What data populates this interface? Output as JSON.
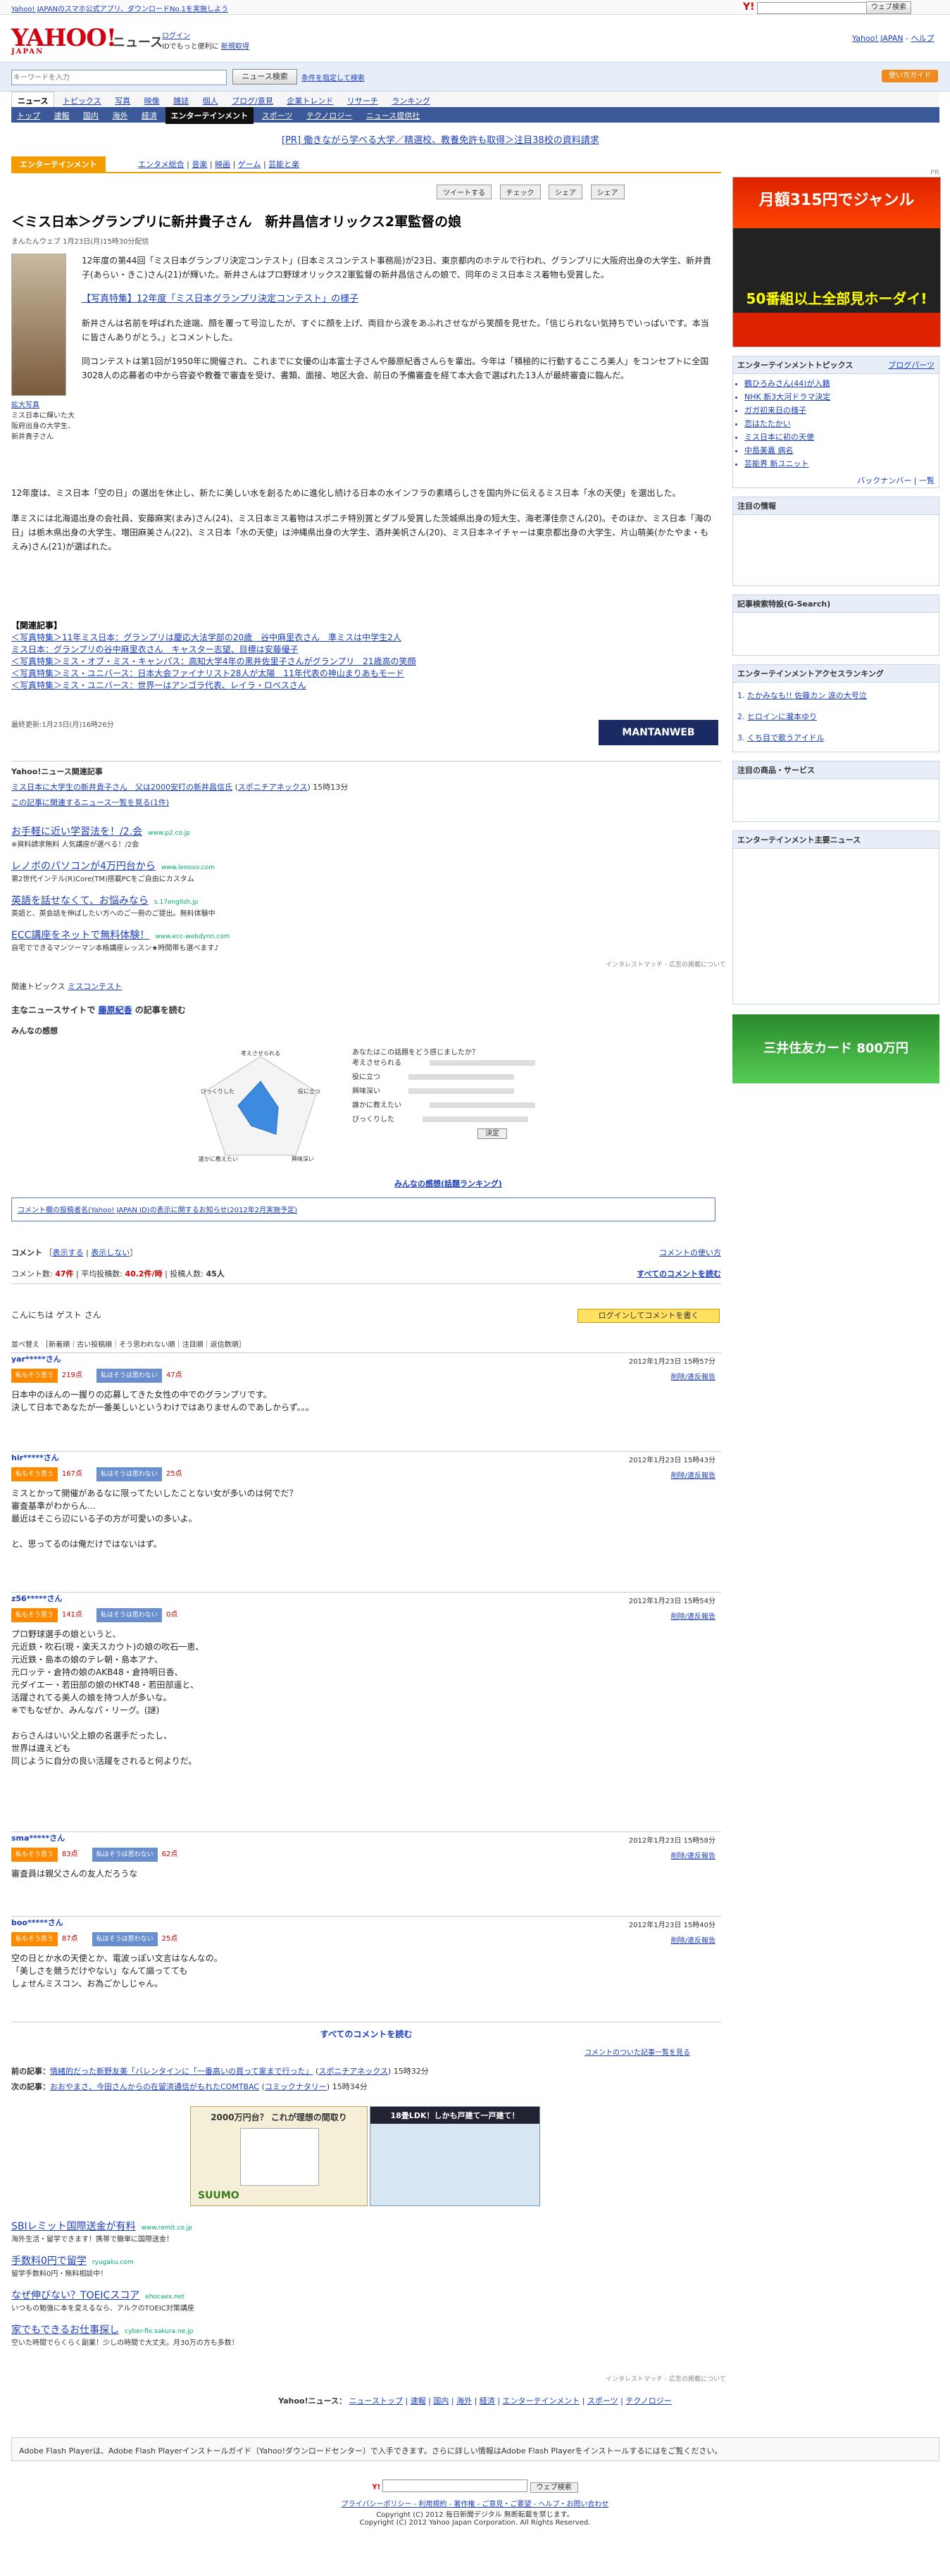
{
  "topbar": {
    "notice": "Yahoo! JAPANのスマホ公式アプリ、ダウンロードNo.1を実施しよう",
    "search_button": "ウェブ検索"
  },
  "header": {
    "logo": "YAHOO!",
    "logo_sub": "JAPAN",
    "service": "ニュース",
    "login": "ログイン",
    "login_note": "IDでもっと便利に",
    "register": "新規取得",
    "yahoo_top": "Yahoo! JAPAN",
    "help": "ヘルプ"
  },
  "search": {
    "placeholder": "キーワードを入力",
    "button": "ニュース検索",
    "advanced": "条件を指定して検索",
    "help_button": "使い方ガイド"
  },
  "nav_primary": [
    "ニュース",
    "トピックス",
    "写真",
    "映像",
    "雑誌",
    "個人",
    "ブログ/意見",
    "企業トレンド",
    "リサーチ",
    "ランキング"
  ],
  "nav_secondary": [
    "トップ",
    "速報",
    "国内",
    "海外",
    "経済",
    "エンターテインメント",
    "スポーツ",
    "テクノロジー",
    "ニュース提供社"
  ],
  "pr_line": "[PR] 働きながら学べる大学／精選校、教養免許も取得＞注目38校の資料請求",
  "category": {
    "label": "エンターテインメント",
    "subs": [
      "エンタメ総合",
      "音楽",
      "映画",
      "ゲーム",
      "芸能と楽"
    ]
  },
  "social": [
    "ツイートする",
    "チェック",
    "シェア",
    "シェア"
  ],
  "article": {
    "title": "＜ミス日本＞グランプリに新井貴子さん　新井昌信オリックス2軍監督の娘",
    "byline": "まんたんウェブ 1月23日(月)15時30分配信",
    "photo_caption": "ミス日本に輝いた大阪府出身の大学生、新井貴子さん",
    "photo_link": "拡大写真",
    "p1": "12年度の第44回「ミス日本グランプリ決定コンテスト」(日本ミスコンテスト事務局)が23日、東京都内のホテルで行われ、グランプリに大阪府出身の大学生、新井貴子(あらい・きこ)さん(21)が輝いた。新井さんはプロ野球オリックス2軍監督の新井昌信さんの娘で、同年のミス日本ミス着物も受賞した。",
    "special_link": "【写真特集】12年度「ミス日本グランプリ決定コンテスト」の様子",
    "p2": "新井さんは名前を呼ばれた途端、顔を覆って号泣したが、すぐに顔を上げ、両目から涙をあふれさせながら笑顔を見せた。「信じられない気持ちでいっぱいです。本当に皆さんありがとう。」とコメントした。",
    "p3": "同コンテストは第1回が1950年に開催され、これまでに女優の山本富士子さんや藤原紀香さんらを輩出。今年は「積極的に行動するこころ美人」をコンセプトに全国3028人の応募者の中から容姿や教養で審査を受け、書類、面接、地区大会、前日の予備審査を経て本大会で選ばれた13人が最終審査に臨んだ。",
    "p4": "12年度は、ミス日本「空の日」の選出を休止し、新たに美しい水を創るために進化し続ける日本の水インフラの素晴らしさを国内外に伝えるミス日本「水の天使」を選出した。",
    "p5": "準ミスには北海道出身の会社員、安藤麻実(まみ)さん(24)、ミス日本ミス着物はスポニチ特別賞とダブル受賞した茨城県出身の短大生、海老澤佳奈さん(20)。そのほか、ミス日本「海の日」は栃木県出身の大学生、増田麻美さん(22)、ミス日本「水の天使」は沖縄県出身の大学生、酒井美帆さん(20)、ミス日本ネイチャーは東京都出身の大学生、片山萌美(かたやま・もえみ)さん(21)が選ばれた。",
    "related_header": "【関連記事】",
    "related": [
      "＜写真特集＞11年ミス日本：グランプリは慶応大法学部の20歳　谷中麻里衣さん　準ミスは中学生2人",
      "ミス日本：グランプリの谷中麻里衣さん　キャスター志望、目標は安藤優子",
      "＜写真特集＞ミス・オブ・ミス・キャンパス：高知大学4年の黒井佐里子さんがグランプリ　21歳高の笑顔",
      "＜写真特集＞ミス・ユニバース：日本大会ファイナリスト28人が太陽　11年代表の神山まりあもモード",
      "＜写真特集＞ミス・ユニバース：世界一はアンゴラ代表、レイラ・ロペスさん"
    ],
    "updated": "最終更新:1月23日(月)16時26分",
    "source_logo": "MANTANWEB"
  },
  "related_news": {
    "header": "Yahoo!ニュース関連記事",
    "item": "ミス日本に大学生の新井貴子さん　父は2000安打の新井昌信氏",
    "source": "スポニチアネックス",
    "time": "15時13分",
    "more": "この記事に関連するニュース一覧を見る(1件)"
  },
  "ads": [
    {
      "h": "お手軽に近い学習法を！/2.会",
      "u": "www.p2.co.jp",
      "d": "※資料請求無料 人気講座が選べる！/2会"
    },
    {
      "h": "レノボのパソコンが4万円台から",
      "u": "www.lenovo.com",
      "d": "第2世代インテル(R)Core(TM)搭載PCをご自由にカスタム"
    },
    {
      "h": "英語を話せなくて、お悩みなら",
      "u": "s.17english.jp",
      "d": "英語と、英会話を伸ばしたい方へのご一冊のご提出。無料体験中"
    },
    {
      "h": "ECC講座をネットで無料体験！",
      "u": "www.ecc-webdynn.com",
      "d": "自宅でできるマンツーマン本格講座レッスン★時間帯も選べます♪"
    }
  ],
  "ad_footer": "インタレストマッチ - 広告の掲載について",
  "topics": {
    "label": "関連トピックス",
    "link": "ミスコンテスト"
  },
  "pickup": {
    "label": "主なニュースサイトで",
    "link": "藤原紀香",
    "suffix": "の記事を読む"
  },
  "feelings": {
    "label": "みんなの感想",
    "question": "あなたはこの話題をどう感じましたか？",
    "axes": [
      "考えさせられる",
      "役に立つ",
      "興味深い",
      "誰かに教えたい",
      "びっくりした"
    ],
    "values": [
      0.6,
      0.35,
      0.5,
      0.3,
      0.45
    ],
    "vote": "決定",
    "ranking": "みんなの感想(話題ランキング)"
  },
  "notice_box": "コメント欄の投稿者名(Yahoo! JAPAN ID)の表示に関するお知らせ(2012年2月実施予定)",
  "comments_meta": {
    "label": "コメント",
    "show": "表示する",
    "hide": "表示しない",
    "how": "コメントの使い方",
    "count_label": "コメント数",
    "count": "47件",
    "avg_label": "平均投稿数",
    "avg": "40.2件/時",
    "posters_label": "投稿人数",
    "posters": "45人",
    "see_all": "すべてのコメントを読む",
    "guest": "こんにちは ゲスト さん",
    "login_btn": "ログインしてコメントを書く",
    "sort": "並べ替え ［新着順｜古い投稿順｜そう思われない順｜注目順｜返信数順］"
  },
  "comments": [
    {
      "user": "yar*****さん",
      "date": "2012年1月23日 15時57分",
      "agree": "219点",
      "disagree": "47点",
      "text": "日本中のほんの一握りの応募してきた女性の中でのグランプリです。\n決して日本であなたが一番美しいというわけではありませんのであしからず。。。"
    },
    {
      "user": "hir*****さん",
      "date": "2012年1月23日 15時43分",
      "agree": "167点",
      "disagree": "25点",
      "text": "ミスとかって開催があるなに限ってたいしたことない女が多いのは何でだ？\n審査基準がわからん…\n最近はそこら辺にいる子の方が可愛いの多いよ。\n\nと、思ってるのは俺だけではないはず。"
    },
    {
      "user": "z56*****さん",
      "date": "2012年1月23日 15時54分",
      "agree": "141点",
      "disagree": "0点",
      "text": "プロ野球選手の娘というと、\n元近鉄・吹石(現・楽天スカウト)の娘の吹石一恵、\n元近鉄・島本の娘のテレ朝・島本アナ、\n元ロッテ・倉持の娘のAKB48・倉持明日香、\n元ダイエー・若田部の娘のHKT48・若田部遥と、\n活躍されてる美人の娘を持つ人が多いな。\n※でもなぜか、みんなパ・リーグ。(謎)\n\nおらさんはいい父上娘の名選手だったし、\n世界は違えども\n同じように自分の良い活躍をされると何よりだ。"
    },
    {
      "user": "sma*****さん",
      "date": "2012年1月23日 15時58分",
      "agree": "83点",
      "disagree": "62点",
      "text": "審査員は親父さんの友人だろうな"
    },
    {
      "user": "boo*****さん",
      "date": "2012年1月23日 15時40分",
      "agree": "87点",
      "disagree": "25点",
      "text": "空の日とか水の天使とか、電波っぽい文言はなんなの。\n「美しさを競うだけやない」なんて謳ってても\nしょせんミスコン、お為ごかしじゃん。"
    }
  ],
  "comment_vote_labels": {
    "agree": "私もそう思う",
    "disagree": "私はそうは思わない",
    "report": "削除/違反報告"
  },
  "all_comments": "すべてのコメントを読む",
  "comments_list_link": "コメントのついた記事一覧を見る",
  "prevnext": {
    "prev_label": "前の記事：",
    "prev": "情緒的だった新野友美「バレンタインに「一番高いの買って家まで行った」",
    "prev_src": "スポニチアネックス",
    "prev_time": "15時32分",
    "next_label": "次の記事：",
    "next": "おおやまさ、今田さんからの在留済通信がもれたCOMTBAC",
    "next_src": "コミックナタリー",
    "next_time": "15時34分"
  },
  "banner": {
    "title": "2000万円台？ これが理想の間取り",
    "brand": "SUUMO",
    "title2": "18畳LDK！しかも戸建て一戸建て！"
  },
  "ads2": [
    {
      "h": "SBIレミット国際送金が有料",
      "u": "www.remit.co.jp",
      "d": "海外生活・留学できます！携帯で簡単に国際送金！"
    },
    {
      "h": "手数料0円で留学",
      "u": "ryugaku.com",
      "d": "留学手数料0円・無料相談中！"
    },
    {
      "h": "なぜ伸びない？TOEICスコア",
      "u": "ehocaex.net",
      "d": "いつもの勉強に本を変えるなら、アルクのTOEIC対策講座"
    },
    {
      "h": "家でもできるお仕事探し",
      "u": "cyber-fle.sakura.ne.jp",
      "d": "空いた時間でらくらく副業！少しの時間で大丈夫。月30万の方も多数！"
    }
  ],
  "footnav": [
    "ニューストップ",
    "速報",
    "国内",
    "海外",
    "経済",
    "エンターテインメント",
    "スポーツ",
    "テクノロジー"
  ],
  "footnav_label": "Yahoo!ニュース：",
  "flash": "Adobe Flash Playerは、Adobe Flash Playerインストールガイド（Yahoo!ダウンロードセンター）で入手できます。さらに詳しい情報はAdobe Flash Playerをインストールするにはをご覧ください。",
  "footer": {
    "links": "プライバシーポリシー - 利用規約 - 著作権 - ご意見・ご要望 - ヘルプ・お問い合わせ",
    "copy1": "Copyright (C) 2012 毎日新聞デジタル 無断転載を禁じます。",
    "copy2": "Copyright (C) 2012 Yahoo Japan Corporation. All Rights Reserved."
  },
  "right": {
    "pr": "PR",
    "bigad_t1": "月額315円でジャンル",
    "bigad_t2": "50番組以上全部見ホーダイ!",
    "topics_header": "エンターテインメントトピックス",
    "topics_more": "ブログパーツ",
    "topics": [
      "鶴ひろみさん(44)が入籍",
      "NHK 新3大河ドラマ決定",
      "ガガ初来日の様子",
      "恋はたたかい",
      "ミス日本に初の天使",
      "中島美嘉 病名",
      "芸能界 新ユニット"
    ],
    "topics_link": "バックナンバー | 一覧",
    "info_header": "注目の情報",
    "search_header": "記事検索特設(G-Search)",
    "ranking_header": "エンターテインメントアクセスランキング",
    "ranking": [
      "たかみなも!! 佐藤カン 涙の大号泣",
      "ヒロインに瀧本ゆり",
      "くち目で歌うアイドル"
    ],
    "others_header": "注目の商品・サービス",
    "headline_header": "エンターテインメント主要ニュース",
    "sankei": "三井住友カード 800万円"
  }
}
